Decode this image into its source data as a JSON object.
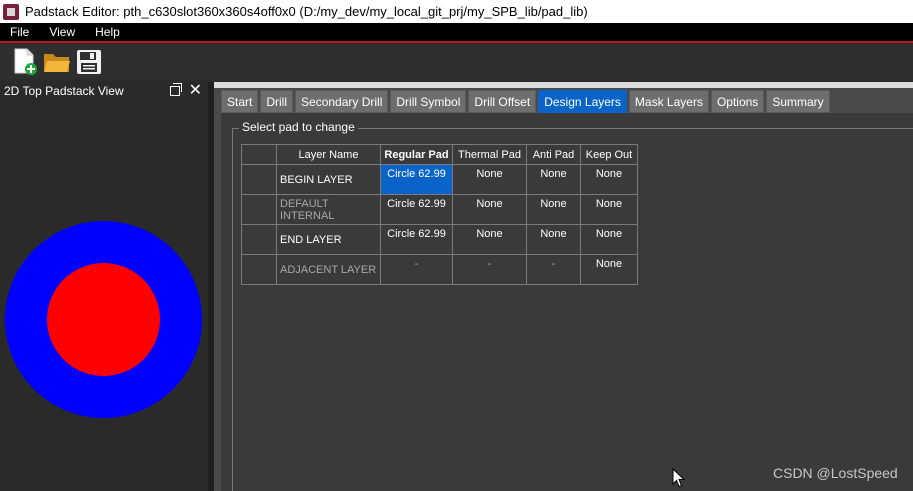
{
  "window": {
    "title": "Padstack Editor: pth_c630slot360x360s4off0x0  (D:/my_dev/my_local_git_prj/my_SPB_lib/pad_lib)"
  },
  "menu": {
    "items": [
      "File",
      "View",
      "Help"
    ]
  },
  "toolbar": {
    "icons": [
      "new-file-icon",
      "open-folder-icon",
      "save-icon"
    ]
  },
  "left_panel": {
    "title": "2D Top Padstack View"
  },
  "tabs": [
    {
      "label": "Start",
      "active": false
    },
    {
      "label": "Drill",
      "active": false
    },
    {
      "label": "Secondary Drill",
      "active": false
    },
    {
      "label": "Drill Symbol",
      "active": false
    },
    {
      "label": "Drill Offset",
      "active": false
    },
    {
      "label": "Design Layers",
      "active": true
    },
    {
      "label": "Mask Layers",
      "active": false
    },
    {
      "label": "Options",
      "active": false
    },
    {
      "label": "Summary",
      "active": false
    }
  ],
  "group": {
    "title": "Select pad to change"
  },
  "table": {
    "headers": [
      "",
      "Layer Name",
      "Regular Pad",
      "Thermal Pad",
      "Anti Pad",
      "Keep Out"
    ],
    "rows": [
      {
        "layer": "BEGIN LAYER",
        "regular": "Circle 62.99",
        "thermal": "None",
        "anti": "None",
        "keepout": "None",
        "dim": false
      },
      {
        "layer": "DEFAULT INTERNAL",
        "regular": "Circle 62.99",
        "thermal": "None",
        "anti": "None",
        "keepout": "None",
        "dim": true
      },
      {
        "layer": "END LAYER",
        "regular": "Circle 62.99",
        "thermal": "None",
        "anti": "None",
        "keepout": "None",
        "dim": false
      },
      {
        "layer": "ADJACENT LAYER",
        "regular": "-",
        "thermal": "-",
        "anti": "-",
        "keepout": "None",
        "dim": true
      }
    ]
  },
  "colors": {
    "outer_pad": "#0000ff",
    "inner_drill": "#ff0000",
    "active_tab": "#0a64c8",
    "menu_accent": "#b21e1e"
  },
  "watermark": "CSDN @LostSpeed"
}
